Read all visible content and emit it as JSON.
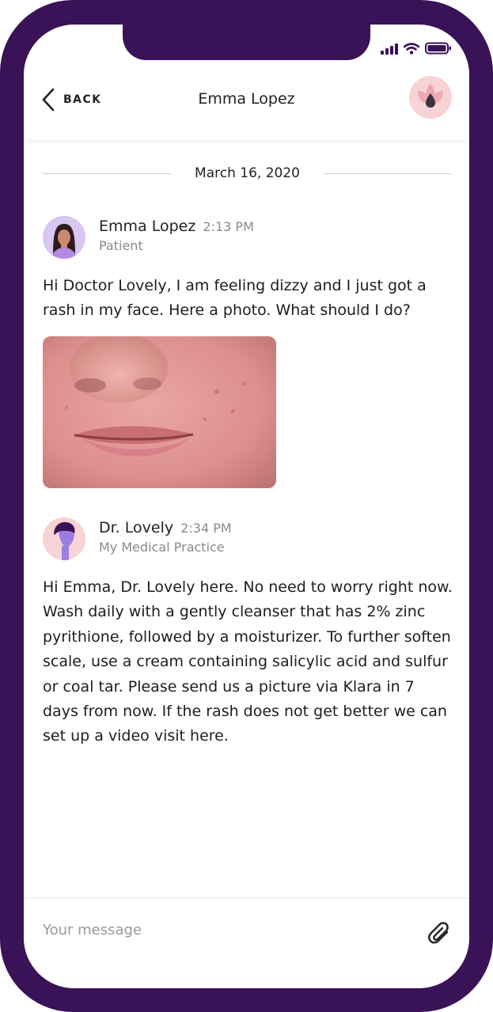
{
  "header": {
    "back_label": "BACK",
    "title": "Emma Lopez",
    "logo_icon": "lotus-icon"
  },
  "status_bar": {
    "icons": [
      "signal-icon",
      "wifi-icon",
      "battery-icon"
    ]
  },
  "conversation": {
    "date": "March 16, 2020",
    "messages": [
      {
        "sender": "Emma Lopez",
        "time": "2:13 PM",
        "role": "Patient",
        "text": "Hi Doctor Lovely, I am feeling dizzy and I just got a rash in my face. Here a photo. What should I do?",
        "attachment": "photo"
      },
      {
        "sender": "Dr. Lovely",
        "time": "2:34 PM",
        "role": "My Medical Practice",
        "text": "Hi Emma, Dr. Lovely here. No need to worry right now. Wash daily with a gently cleanser that has 2% zinc pyrithione, followed by a moisturizer. To further soften scale, use a cream containing salicylic acid and sulfur or coal tar. Please send us a picture via Klara in 7 days from now. If the rash does not get better we can set up a video visit here."
      }
    ]
  },
  "composer": {
    "placeholder": "Your message",
    "value": "",
    "attach_icon": "paperclip-icon"
  },
  "colors": {
    "frame": "#3a1257",
    "accent_pink": "#f8d3d5",
    "avatar_lavender": "#d8c7f2",
    "text": "#222222",
    "muted": "#8a8a8a"
  }
}
